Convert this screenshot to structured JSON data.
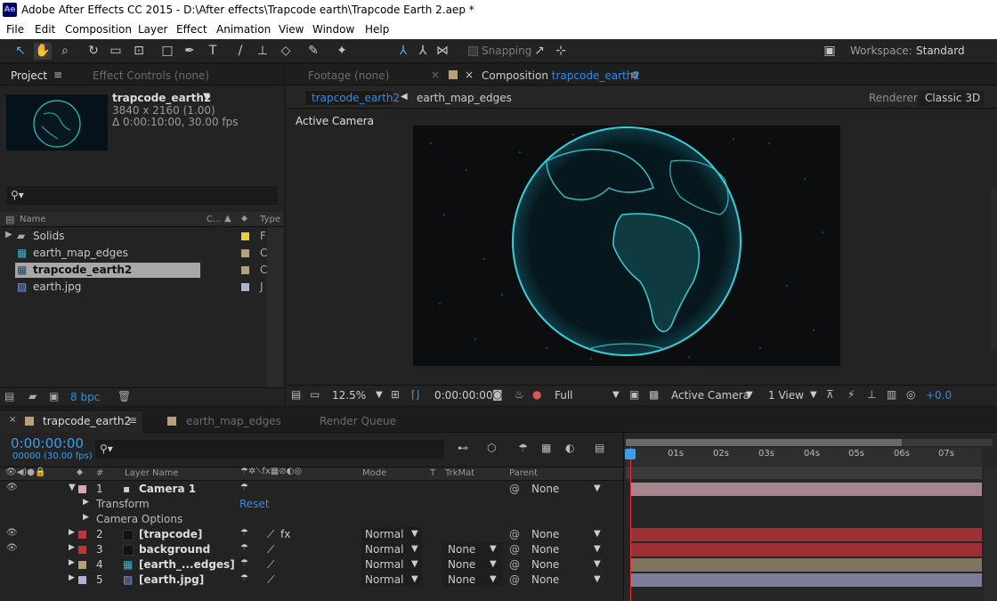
{
  "window": {
    "title": "Adobe After Effects CC 2015 - D:\\After effects\\Trapcode earth\\Trapcode Earth 2.aep *",
    "logo": "Ae"
  },
  "menu": [
    "File",
    "Edit",
    "Composition",
    "Layer",
    "Effect",
    "Animation",
    "View",
    "Window",
    "Help"
  ],
  "toolbar": {
    "snapping": "Snapping",
    "workspace_label": "Workspace:",
    "workspace_value": "Standard"
  },
  "project": {
    "tab_label": "Project",
    "effect_controls_tab": "Effect Controls (none)",
    "item_name": "trapcode_earth2",
    "item_size": "3840 x 2160 (1.00)",
    "item_duration": "Δ 0:00:10:00, 30.00 fps",
    "col_name": "Name",
    "col_c": "C...",
    "col_type": "Type",
    "items": [
      {
        "name": "Solids",
        "color": "#e6cf3a",
        "type": "F"
      },
      {
        "name": "earth_map_edges",
        "color": "#b5a07a",
        "type": "C"
      },
      {
        "name": "trapcode_earth2",
        "color": "#b5a07a",
        "type": "C"
      },
      {
        "name": "earth.jpg",
        "color": "#aeb0d8",
        "type": "J"
      }
    ],
    "bpc": "8 bpc"
  },
  "viewer": {
    "footage_tab": "Footage (none)",
    "comp_tab_prefix": "Composition",
    "comp_tab_name": "trapcode_earth2",
    "breadcrumb_active": "trapcode_earth2",
    "breadcrumb_next": "earth_map_edges",
    "renderer_label": "Renderer:",
    "renderer_value": "Classic 3D",
    "camera_label": "Active Camera",
    "zoom": "12.5%",
    "timecode": "0:00:00:00",
    "resolution": "Full",
    "camera_select": "Active Camera",
    "view_select": "1 View",
    "exposure": "+0.0"
  },
  "timeline": {
    "tabs": [
      {
        "label": "trapcode_earth2",
        "color": "#b5a07a"
      },
      {
        "label": "earth_map_edges",
        "color": "#b5a07a"
      },
      {
        "label": "Render Queue",
        "color": ""
      }
    ],
    "timecode": "0:00:00:00",
    "fps_line": "00000 (30.00 fps)",
    "col_layer_name": "Layer Name",
    "col_mode": "Mode",
    "col_t": "T",
    "col_trkmat": "TrkMat",
    "col_parent": "Parent",
    "col_num": "#",
    "ruler": [
      "01s",
      "02s",
      "03s",
      "04s",
      "05s",
      "06s",
      "07s"
    ],
    "transform": "Transform",
    "transform_reset": "Reset",
    "camera_options": "Camera Options",
    "layers": [
      {
        "num": "1",
        "name": "Camera 1",
        "color": "#d9a6b4",
        "mode": "",
        "trkmat": "",
        "parent": "None",
        "bar": "#a7858e"
      },
      {
        "num": "2",
        "name": "[trapcode]",
        "color": "#b8393a",
        "mode": "Normal",
        "trkmat": "",
        "parent": "None",
        "bar": "#9a3234"
      },
      {
        "num": "3",
        "name": "background",
        "color": "#b8393a",
        "mode": "Normal",
        "trkmat": "None",
        "parent": "None",
        "bar": "#9a3234"
      },
      {
        "num": "4",
        "name": "[earth_...edges]",
        "color": "#b5a07a",
        "mode": "Normal",
        "trkmat": "None",
        "parent": "None",
        "bar": "#7e7460"
      },
      {
        "num": "5",
        "name": "[earth.jpg]",
        "color": "#aeb0d8",
        "mode": "Normal",
        "trkmat": "None",
        "parent": "None",
        "bar": "#7c7e98"
      }
    ]
  }
}
